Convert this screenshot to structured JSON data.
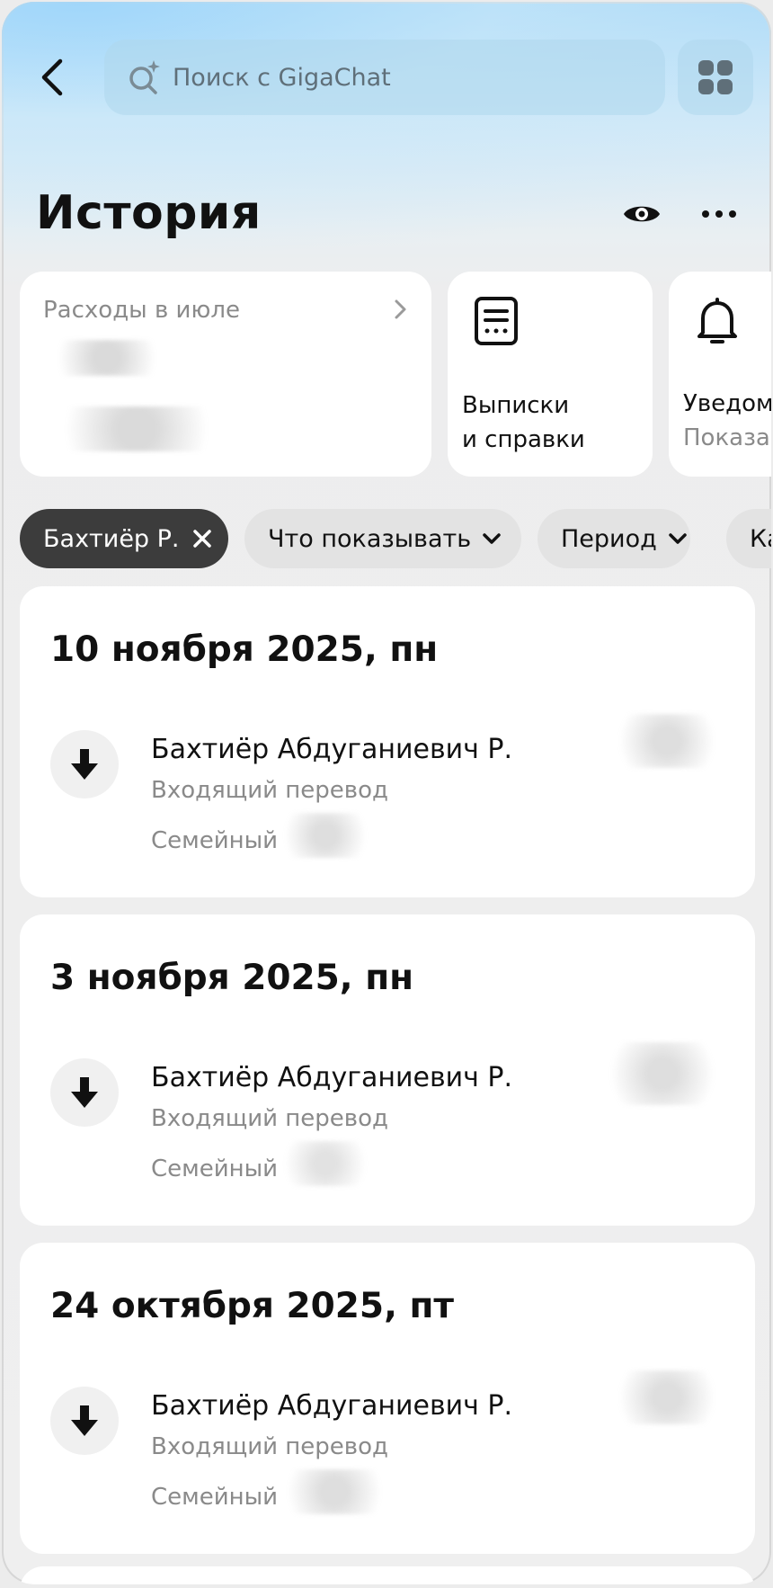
{
  "header": {
    "search_placeholder": "Поиск с GigaChat",
    "title": "История"
  },
  "cards": {
    "spending_label": "Расходы в июле",
    "statements_line1": "Выписки",
    "statements_line2": "и справки",
    "notifications_title": "Уведом",
    "notifications_sub": "Показа"
  },
  "filters": {
    "active_chip": "Бахтиёр Р.",
    "what_to_show": "Что показывать",
    "period": "Период",
    "category": "Ка"
  },
  "transactions": [
    {
      "date": "10 ноября 2025, пн",
      "name": "Бахтиёр Абдуганиевич Р.",
      "type": "Входящий перевод",
      "category": "Семейный"
    },
    {
      "date": "3 ноября 2025, пн",
      "name": "Бахтиёр Абдуганиевич Р.",
      "type": "Входящий перевод",
      "category": "Семейный"
    },
    {
      "date": "24 октября 2025, пт",
      "name": "Бахтиёр Абдуганиевич Р.",
      "type": "Входящий перевод",
      "category": "Семейный"
    }
  ],
  "colors": {
    "accent_dark": "#3c3c3c",
    "gradient_top": "#a9d8f7",
    "background": "#efefef"
  }
}
